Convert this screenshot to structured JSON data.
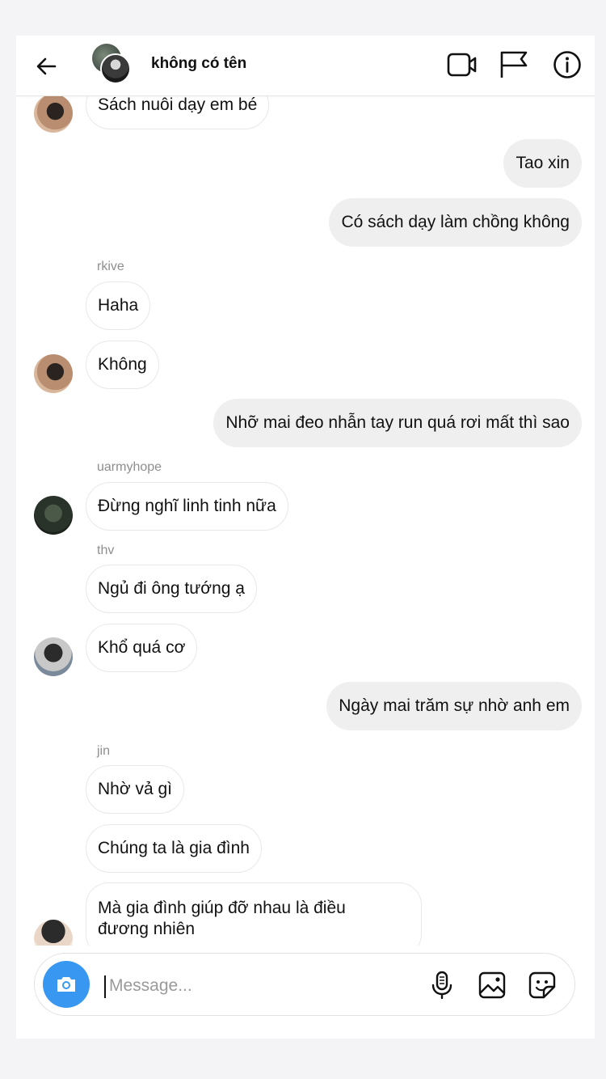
{
  "header": {
    "title": "không có tên",
    "icons": [
      "back-arrow-icon",
      "video-call-icon",
      "flag-icon",
      "info-icon"
    ]
  },
  "messages": [
    {
      "side": "in",
      "sender": "",
      "text": "Sách nuôi dạy em bé"
    },
    {
      "side": "out",
      "text": "Tao xin"
    },
    {
      "side": "out",
      "text": "Có sách dạy làm chồng không"
    },
    {
      "side": "in",
      "sender": "rkive",
      "text": "Haha"
    },
    {
      "side": "in",
      "sender": "",
      "text": "Không"
    },
    {
      "side": "out",
      "text": "Nhỡ mai đeo nhẫn tay run quá rơi mất thì sao"
    },
    {
      "side": "in",
      "sender": "uarmyhope",
      "text": "Đừng nghĩ linh tinh nữa"
    },
    {
      "side": "in",
      "sender": "thv",
      "text": "Ngủ đi ông tướng ạ"
    },
    {
      "side": "in",
      "sender": "",
      "text": "Khổ quá cơ"
    },
    {
      "side": "out",
      "text": "Ngày mai trăm sự nhờ anh em"
    },
    {
      "side": "in",
      "sender": "jin",
      "text": "Nhờ vả gì"
    },
    {
      "side": "in",
      "sender": "",
      "text": "Chúng ta là gia đình"
    },
    {
      "side": "in",
      "sender": "",
      "text": "Mà gia đình giúp đỡ nhau là điều đương nhiên"
    }
  ],
  "composer": {
    "placeholder": "Message...",
    "icons": [
      "camera-icon",
      "microphone-icon",
      "gallery-icon",
      "sticker-icon"
    ]
  },
  "colors": {
    "camera_button": "#3897f0",
    "outgoing_bubble": "#efefef",
    "sender_label": "#8e8e8e"
  }
}
